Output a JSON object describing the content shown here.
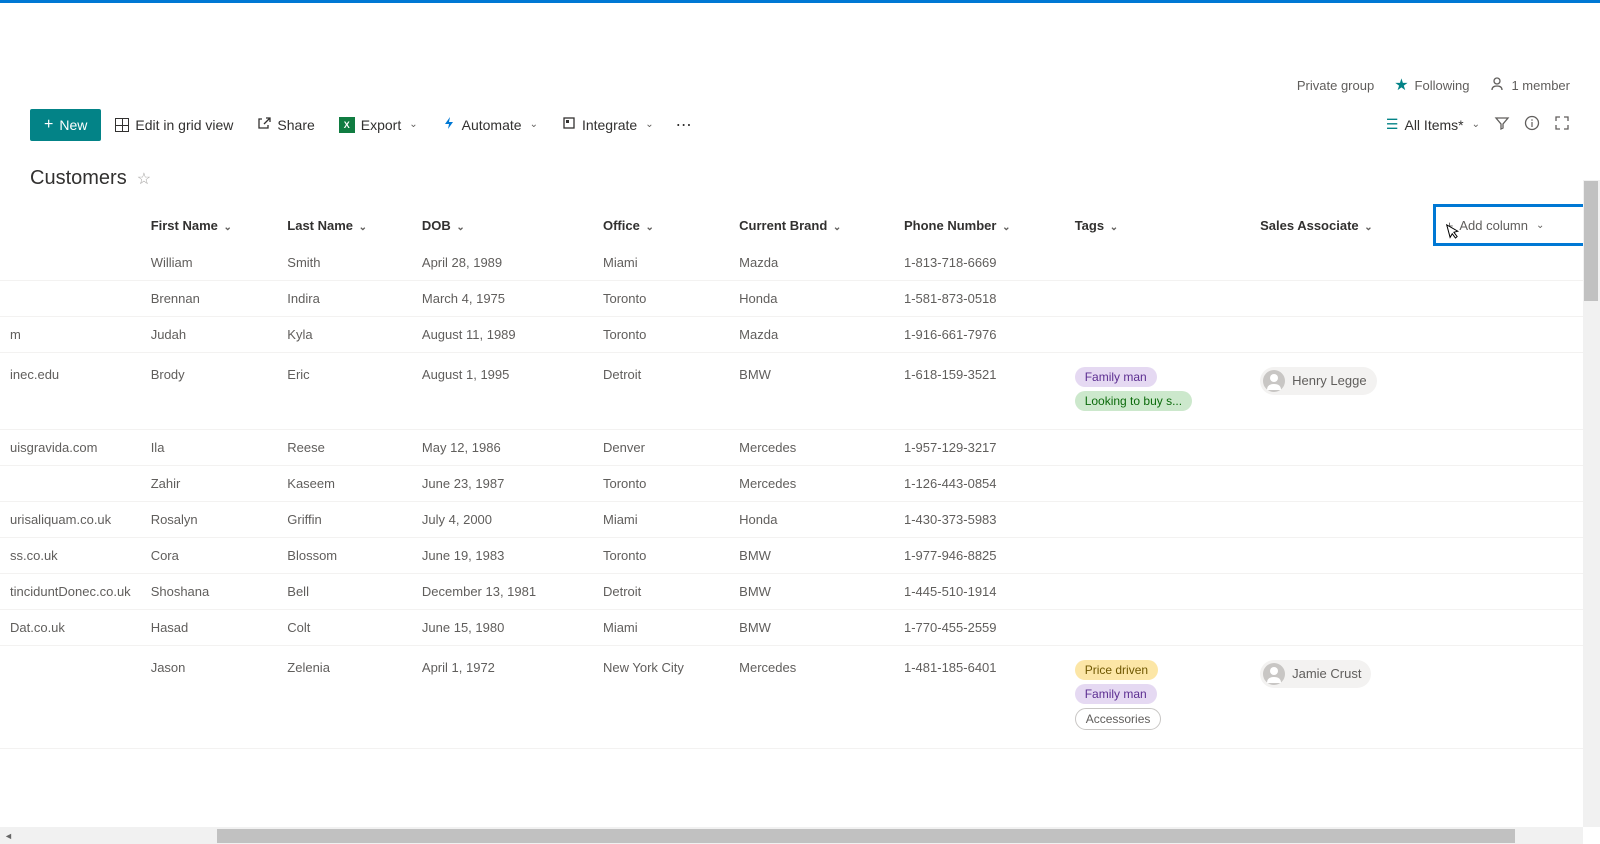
{
  "header": {
    "private_group": "Private group",
    "following": "Following",
    "members": "1 member"
  },
  "toolbar": {
    "new": "New",
    "edit_grid": "Edit in grid view",
    "share": "Share",
    "export": "Export",
    "automate": "Automate",
    "integrate": "Integrate",
    "all_items": "All Items*"
  },
  "list": {
    "title": "Customers"
  },
  "columns": {
    "first_name": "First Name",
    "last_name": "Last Name",
    "dob": "DOB",
    "office": "Office",
    "current_brand": "Current Brand",
    "phone": "Phone Number",
    "tags": "Tags",
    "sales_assoc": "Sales Associate",
    "add_column": "Add column"
  },
  "rows": [
    {
      "email": "",
      "first": "William",
      "last": "Smith",
      "dob": "April 28, 1989",
      "office": "Miami",
      "brand": "Mazda",
      "phone": "1-813-718-6669",
      "tags": [],
      "assoc": ""
    },
    {
      "email": "",
      "first": "Brennan",
      "last": "Indira",
      "dob": "March 4, 1975",
      "office": "Toronto",
      "brand": "Honda",
      "phone": "1-581-873-0518",
      "tags": [],
      "assoc": ""
    },
    {
      "email": "m",
      "first": "Judah",
      "last": "Kyla",
      "dob": "August 11, 1989",
      "office": "Toronto",
      "brand": "Mazda",
      "phone": "1-916-661-7976",
      "tags": [],
      "assoc": ""
    },
    {
      "email": "inec.edu",
      "first": "Brody",
      "last": "Eric",
      "dob": "August 1, 1995",
      "office": "Detroit",
      "brand": "BMW",
      "phone": "1-618-159-3521",
      "tags": [
        "Family man",
        "Looking to buy s..."
      ],
      "assoc": "Henry Legge"
    },
    {
      "email": "uisgravida.com",
      "first": "Ila",
      "last": "Reese",
      "dob": "May 12, 1986",
      "office": "Denver",
      "brand": "Mercedes",
      "phone": "1-957-129-3217",
      "tags": [],
      "assoc": ""
    },
    {
      "email": "",
      "first": "Zahir",
      "last": "Kaseem",
      "dob": "June 23, 1987",
      "office": "Toronto",
      "brand": "Mercedes",
      "phone": "1-126-443-0854",
      "tags": [],
      "assoc": ""
    },
    {
      "email": "urisaliquam.co.uk",
      "first": "Rosalyn",
      "last": "Griffin",
      "dob": "July 4, 2000",
      "office": "Miami",
      "brand": "Honda",
      "phone": "1-430-373-5983",
      "tags": [],
      "assoc": ""
    },
    {
      "email": "ss.co.uk",
      "first": "Cora",
      "last": "Blossom",
      "dob": "June 19, 1983",
      "office": "Toronto",
      "brand": "BMW",
      "phone": "1-977-946-8825",
      "tags": [],
      "assoc": ""
    },
    {
      "email": "tinciduntDonec.co.uk",
      "first": "Shoshana",
      "last": "Bell",
      "dob": "December 13, 1981",
      "office": "Detroit",
      "brand": "BMW",
      "phone": "1-445-510-1914",
      "tags": [],
      "assoc": ""
    },
    {
      "email": "Dat.co.uk",
      "first": "Hasad",
      "last": "Colt",
      "dob": "June 15, 1980",
      "office": "Miami",
      "brand": "BMW",
      "phone": "1-770-455-2559",
      "tags": [],
      "assoc": ""
    },
    {
      "email": "",
      "first": "Jason",
      "last": "Zelenia",
      "dob": "April 1, 1972",
      "office": "New York City",
      "brand": "Mercedes",
      "phone": "1-481-185-6401",
      "tags": [
        "Price driven",
        "Family man",
        "Accessories"
      ],
      "assoc": "Jamie Crust"
    }
  ],
  "tag_colors": {
    "Family man": "tag-purple",
    "Looking to buy s...": "tag-green",
    "Price driven": "tag-yellow",
    "Accessories": "tag-outline"
  }
}
